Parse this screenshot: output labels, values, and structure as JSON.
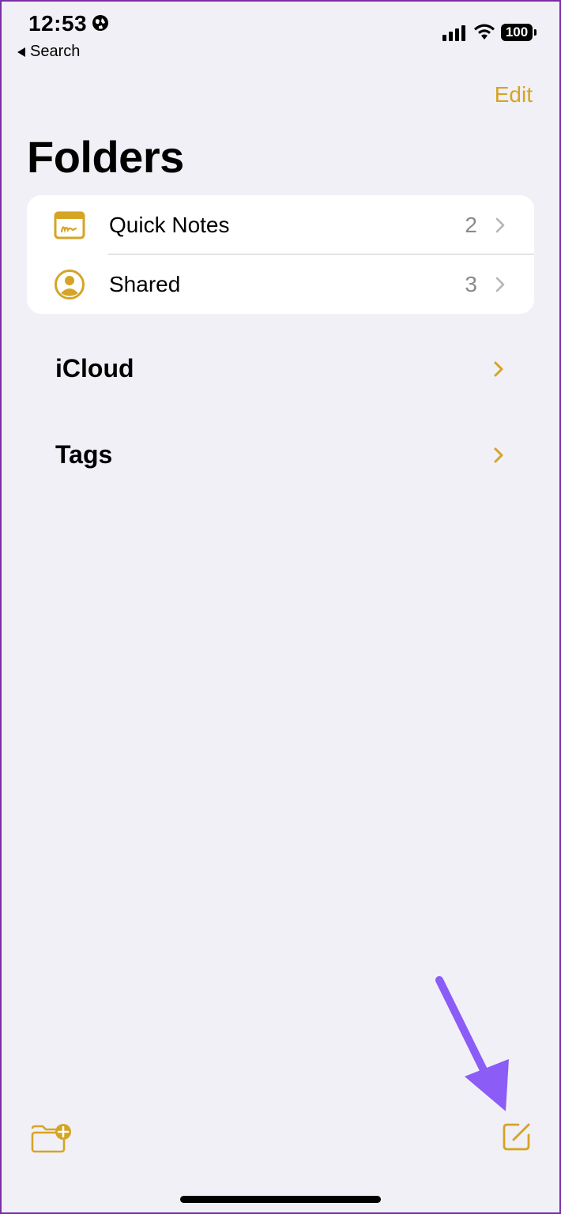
{
  "status_bar": {
    "time": "12:53",
    "back_label": "Search",
    "battery": "100"
  },
  "nav": {
    "edit_label": "Edit"
  },
  "page": {
    "title": "Folders"
  },
  "folders": [
    {
      "label": "Quick Notes",
      "count": "2",
      "icon": "quick-notes-icon"
    },
    {
      "label": "Shared",
      "count": "3",
      "icon": "shared-person-icon"
    }
  ],
  "sections": [
    {
      "label": "iCloud"
    },
    {
      "label": "Tags"
    }
  ],
  "toolbar": {
    "new_folder_icon": "new-folder-icon",
    "compose_icon": "compose-icon"
  },
  "colors": {
    "accent": "#d6a424",
    "background": "#f1f0f6",
    "annotation_arrow": "#8b5cf6"
  }
}
